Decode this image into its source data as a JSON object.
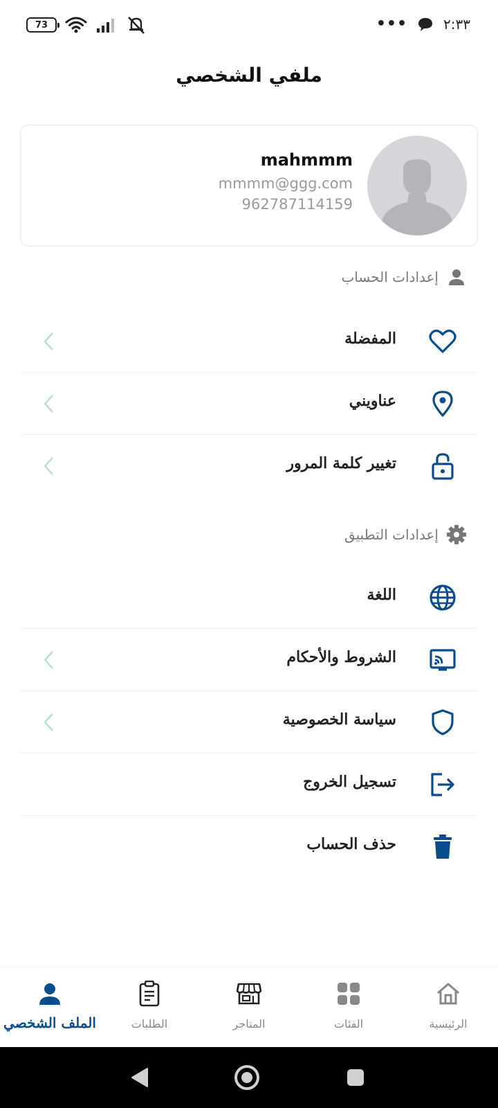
{
  "status_bar": {
    "battery": "73",
    "time": "٢:٣٣",
    "overflow": "•••"
  },
  "header": {
    "title": "ملفي الشخصي"
  },
  "profile": {
    "name": "mahmmm",
    "email": "mmmm@ggg.com",
    "phone": "962787114159"
  },
  "account_settings": {
    "title": "إعدادات الحساب",
    "items": [
      {
        "label": "المفضلة",
        "icon": "heart-icon"
      },
      {
        "label": "عناويني",
        "icon": "location-pin-icon"
      },
      {
        "label": "تغيير كلمة المرور",
        "icon": "unlock-icon"
      }
    ]
  },
  "app_settings": {
    "title": "إعدادات التطبيق",
    "items": [
      {
        "label": "اللغة",
        "icon": "globe-icon"
      },
      {
        "label": "الشروط والأحكام",
        "icon": "cast-icon"
      },
      {
        "label": "سياسة الخصوصية",
        "icon": "shield-icon"
      },
      {
        "label": "تسجيل الخروج",
        "icon": "logout-icon"
      },
      {
        "label": "حذف الحساب",
        "icon": "trash-icon"
      }
    ]
  },
  "bottom_nav": {
    "items": [
      {
        "label": "الرئيسية",
        "icon": "home-icon"
      },
      {
        "label": "الفئات",
        "icon": "grid-icon"
      },
      {
        "label": "المتاجر",
        "icon": "store-icon"
      },
      {
        "label": "الطلبات",
        "icon": "clipboard-icon"
      },
      {
        "label": "الملف الشخصي",
        "icon": "person-icon",
        "active": true
      }
    ]
  },
  "colors": {
    "primary": "#0a4d8f",
    "chevron": "#b9dcd8",
    "muted_text": "#9a9a9a",
    "section_icon": "#777777"
  }
}
